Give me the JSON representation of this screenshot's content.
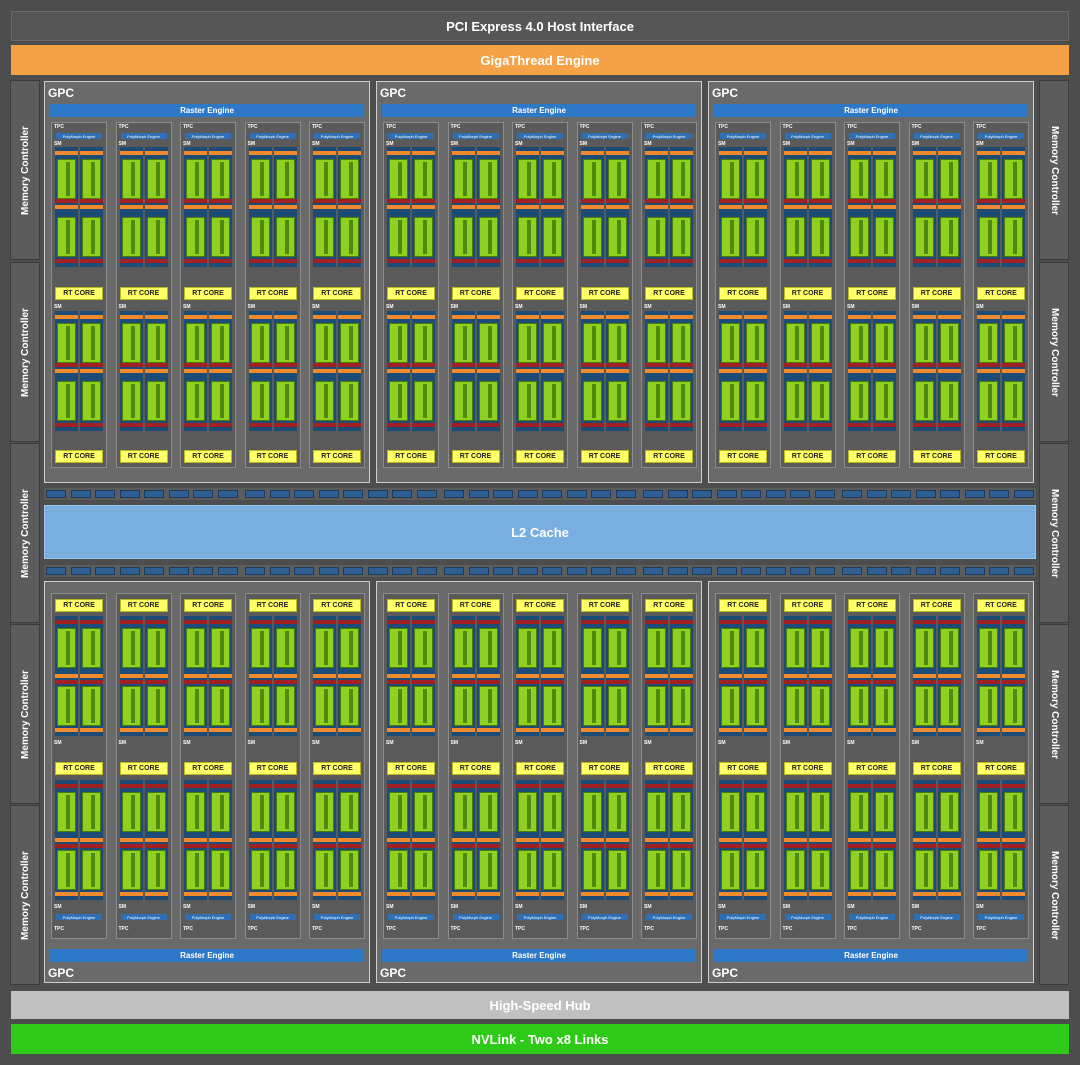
{
  "host_interface": "PCI Express 4.0 Host Interface",
  "gigathread_engine": "GigaThread Engine",
  "memory_controller_label": "Memory Controller",
  "l2_cache": "L2 Cache",
  "high_speed_hub": "High-Speed Hub",
  "nvlink": "NVLink - Two x8 Links",
  "gpc_label": "GPC",
  "raster_engine_label": "Raster Engine",
  "tpc_label": "TPC",
  "polymorph_label": "PolyMorph Engine",
  "sm_label": "SM",
  "rt_core_label": "RT CORE",
  "colors": {
    "host_bar": "#565656",
    "gigathread": "#f5a146",
    "l2_cache": "#78aee0",
    "hub": "#c0c0c0",
    "nvlink": "#2dcb17",
    "raster": "#2e78c8",
    "rt_core": "#ffff66",
    "cuda_cores": "#8fd11e"
  }
}
